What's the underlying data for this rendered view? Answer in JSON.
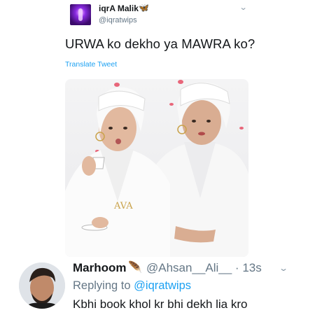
{
  "tweet": {
    "author_name": "iqrA Malik",
    "author_badge_icon": "butterfly-icon",
    "author_handle": "@iqratwips",
    "text": "URWA ko dekho ya MAWRA ko?",
    "translate_label": "Translate Tweet",
    "menu_icon": "chevron-down-icon",
    "media": {
      "description_icon": "photo-two-women-in-bathrobes",
      "robe_logo_text": "AVA"
    }
  },
  "reply": {
    "author_name": "Marhoom",
    "author_emoji": "feather-emoji-icon",
    "author_handle": "@Ahsan__Ali__",
    "separator": "·",
    "time": "13s",
    "replying_to_label": "Replying to",
    "replying_to_handle": "@iqratwips",
    "text": "Kbhi book khol kr bhi dekh lia kro",
    "menu_icon": "chevron-down-icon"
  },
  "colors": {
    "link_blue": "#1da1f2",
    "muted_gray": "#657786",
    "text_dark": "#14171a"
  }
}
